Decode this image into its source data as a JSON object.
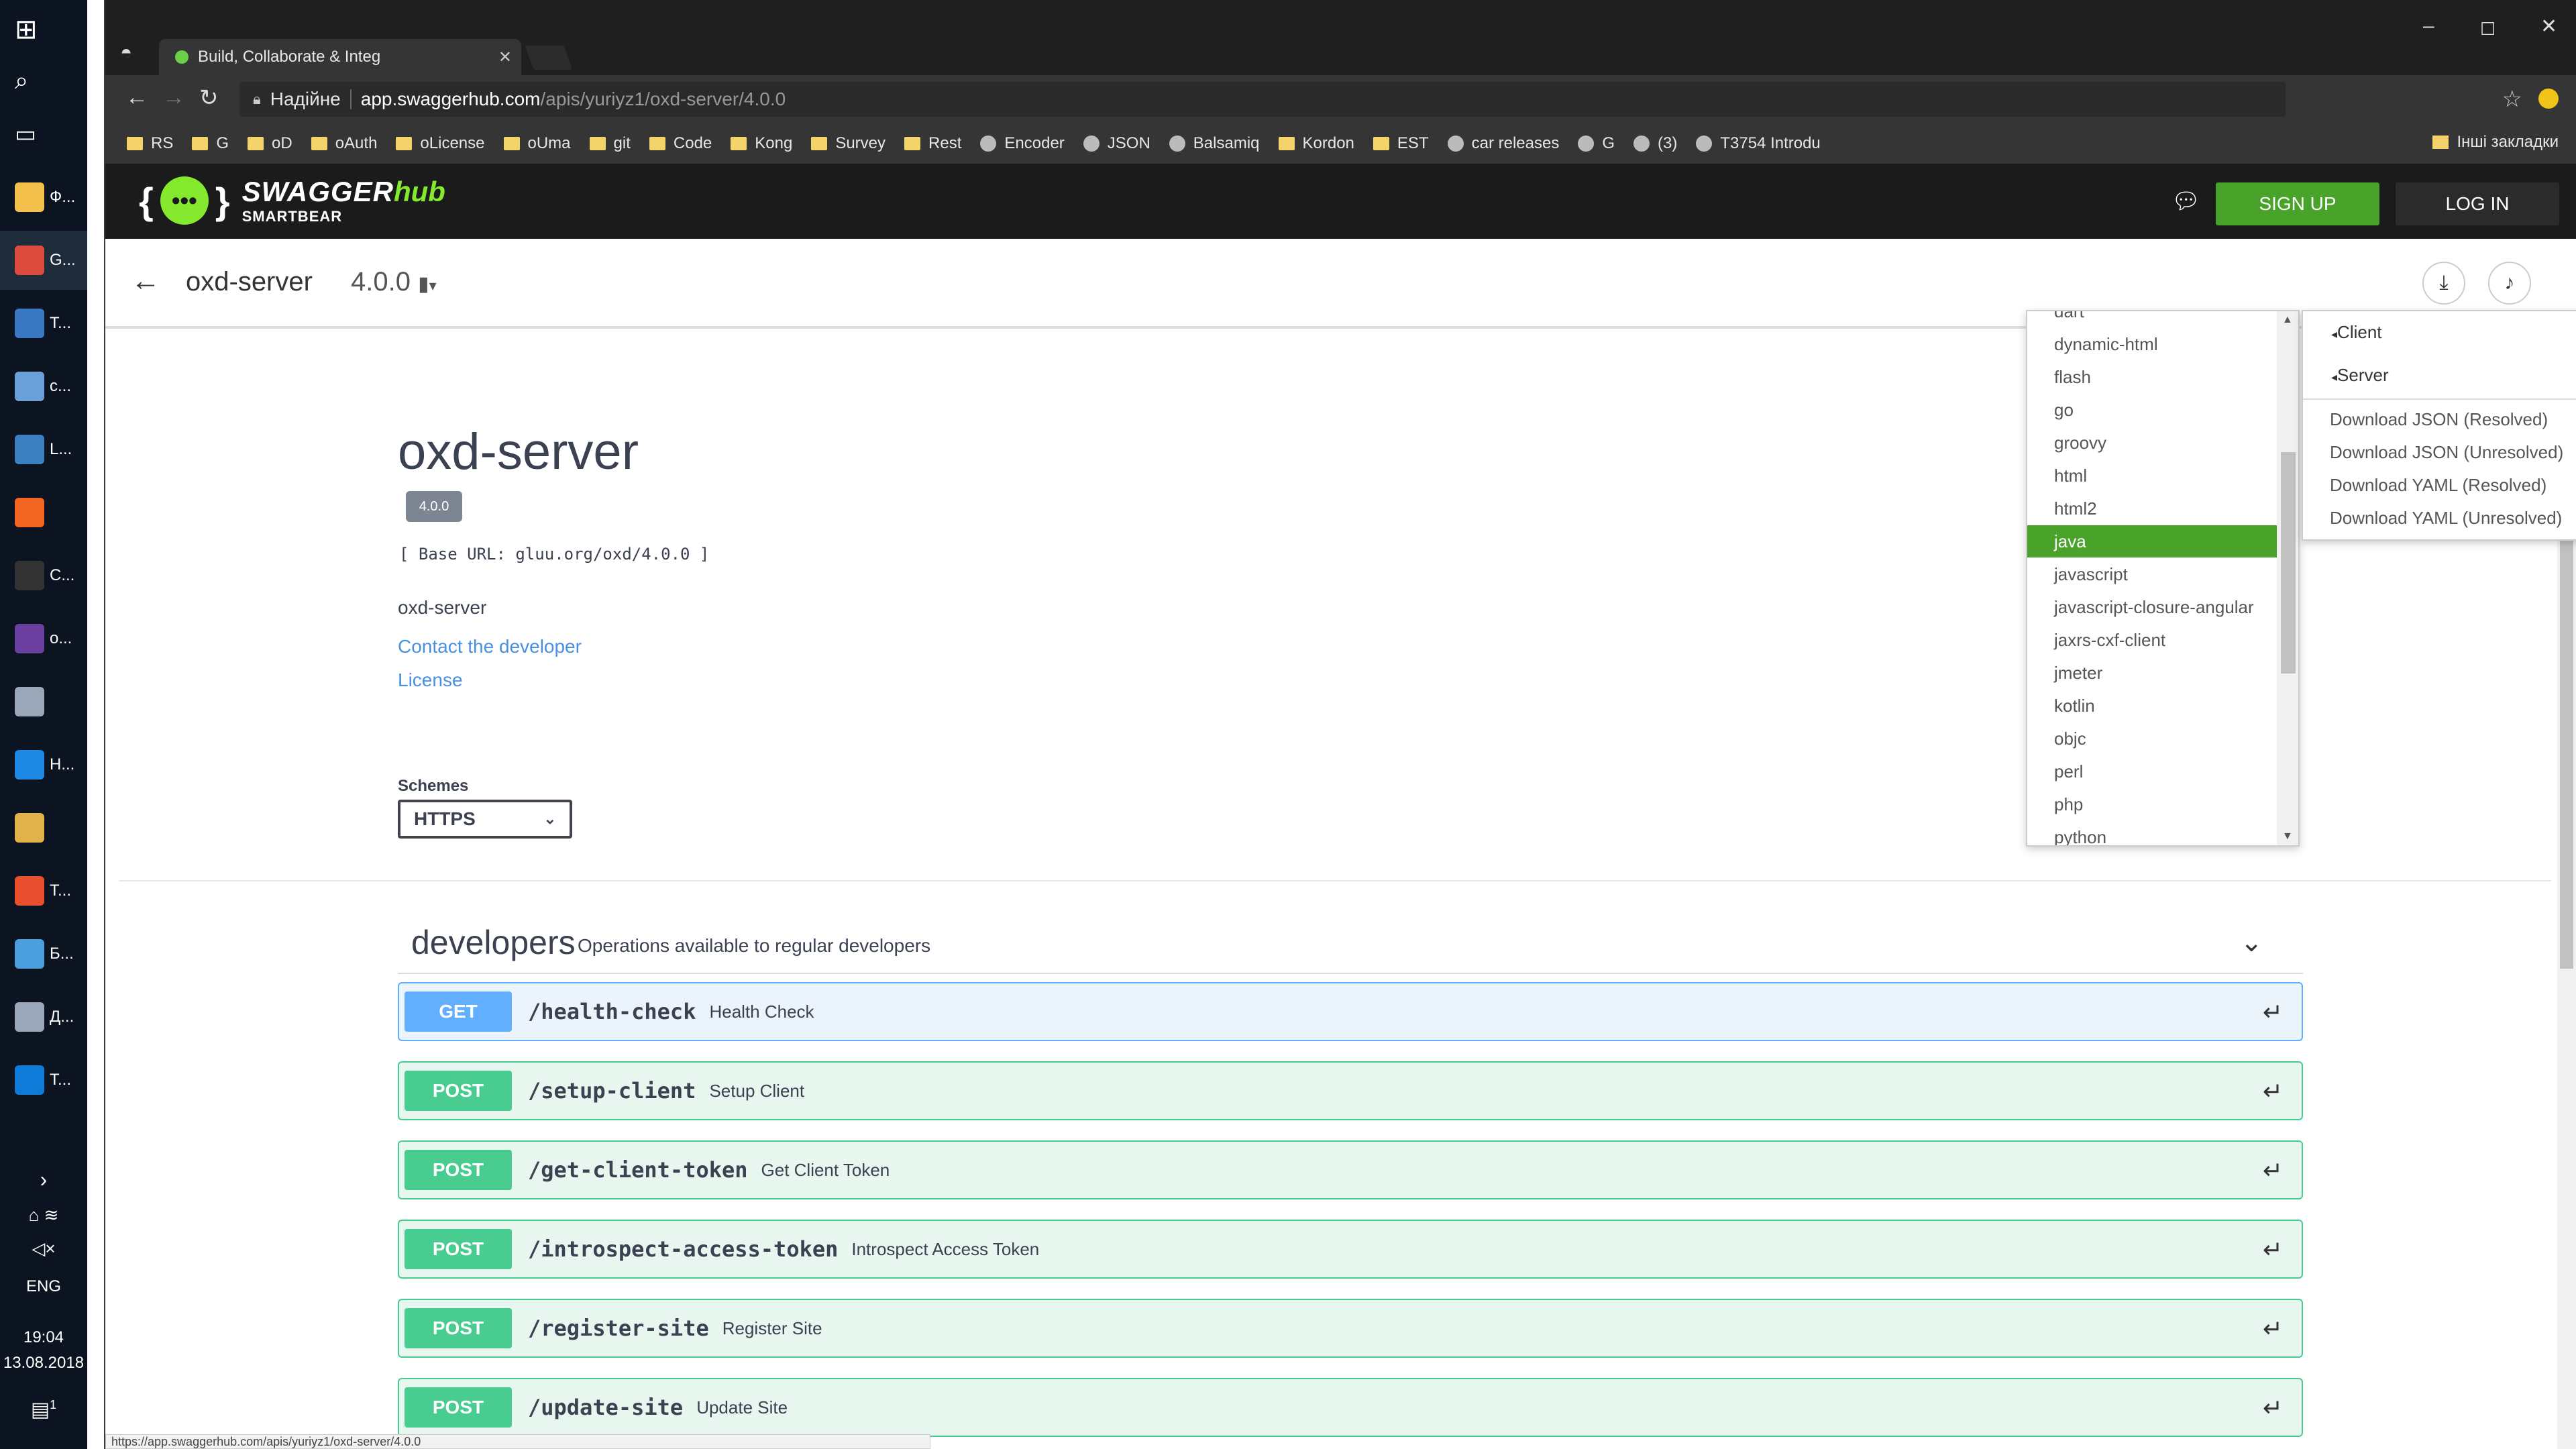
{
  "taskbar": {
    "items": [
      {
        "label": "Ф...",
        "color": "#f4c04c"
      },
      {
        "label": "G...",
        "color": "#dd4b3e"
      },
      {
        "label": "T...",
        "color": "#3b78c3"
      },
      {
        "label": "c...",
        "color": "#6aa0d8"
      },
      {
        "label": "L...",
        "color": "#3a7fbf"
      },
      {
        "label": "",
        "color": "#f26522"
      },
      {
        "label": "C...",
        "color": "#333333"
      },
      {
        "label": "o...",
        "color": "#6b3fa0"
      },
      {
        "label": "",
        "color": "#9aa7b8"
      },
      {
        "label": "H...",
        "color": "#1e88e5"
      },
      {
        "label": "",
        "color": "#e0b34a"
      },
      {
        "label": "T...",
        "color": "#e94f2f"
      },
      {
        "label": "Б...",
        "color": "#4a9fdc"
      },
      {
        "label": "Д...",
        "color": "#9aa7b8"
      },
      {
        "label": "T...",
        "color": "#0e7bd8"
      }
    ],
    "lang": "ENG",
    "time": "19:04",
    "date": "13.08.2018",
    "notif_count": "1"
  },
  "browser": {
    "tab_title": "Build, Collaborate & Integ",
    "secure_label": "Надійне",
    "url_host": "app.swaggerhub.com",
    "url_path": "/apis/yuriyz1/oxd-server/4.0.0",
    "bookmarks": [
      "RS",
      "G",
      "oD",
      "oAuth",
      "oLicense",
      "oUma",
      "git",
      "Code",
      "Kong",
      "Survey",
      "Rest",
      "Encoder",
      "JSON",
      "Balsamiq",
      "Kordon",
      "EST",
      "car releases",
      "G",
      "(3)",
      "T3754 Introdu"
    ],
    "other_bookmarks": "Інші закладки",
    "status_url": "https://app.swaggerhub.com/apis/yuriyz1/oxd-server/4.0.0"
  },
  "header": {
    "logo_swagger": "SWAGGER",
    "logo_hub": "hub",
    "logo_sub": "SMARTBEAR",
    "signup": "SIGN UP",
    "login": "LOG IN"
  },
  "subheader": {
    "api_name": "oxd-server",
    "version": "4.0.0"
  },
  "info": {
    "title": "oxd-server",
    "version_badge": "4.0.0",
    "base_url": "[ Base URL: gluu.org/oxd/4.0.0 ]",
    "description": "oxd-server",
    "contact": "Contact the developer",
    "license": "License",
    "schemes_label": "Schemes",
    "scheme": "HTTPS"
  },
  "tag": {
    "name": "developers",
    "description": "Operations available to regular developers"
  },
  "operations": [
    {
      "method": "GET",
      "path": "/health-check",
      "summary": "Health Check"
    },
    {
      "method": "POST",
      "path": "/setup-client",
      "summary": "Setup Client"
    },
    {
      "method": "POST",
      "path": "/get-client-token",
      "summary": "Get Client Token"
    },
    {
      "method": "POST",
      "path": "/introspect-access-token",
      "summary": "Introspect Access Token"
    },
    {
      "method": "POST",
      "path": "/register-site",
      "summary": "Register Site"
    },
    {
      "method": "POST",
      "path": "/update-site",
      "summary": "Update Site"
    }
  ],
  "language_list": {
    "items": [
      "dart",
      "dynamic-html",
      "flash",
      "go",
      "groovy",
      "html",
      "html2",
      "java",
      "javascript",
      "javascript-closure-angular",
      "jaxrs-cxf-client",
      "jmeter",
      "kotlin",
      "objc",
      "perl",
      "php",
      "python"
    ],
    "selected": "java"
  },
  "download_menu": {
    "client": "Client",
    "server": "Server",
    "items": [
      "Download JSON (Resolved)",
      "Download JSON (Unresolved)",
      "Download YAML (Resolved)",
      "Download YAML (Unresolved)"
    ]
  },
  "colors": {
    "accent": "#49a32b",
    "get": "#61affe",
    "post": "#49cc90",
    "link": "#4990e2"
  }
}
